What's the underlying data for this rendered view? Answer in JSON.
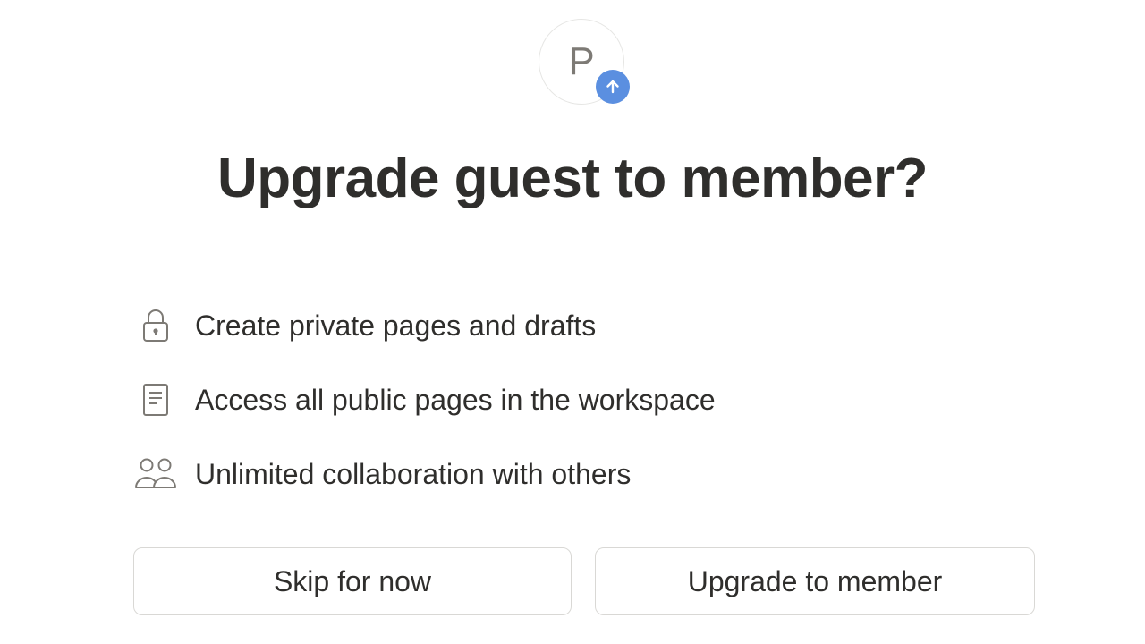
{
  "avatar": {
    "initial": "P",
    "badge_icon": "arrow-up-icon",
    "badge_color": "#5b8fe0"
  },
  "dialog": {
    "title": "Upgrade guest to member?"
  },
  "features": [
    {
      "icon": "lock-icon",
      "label": "Create private pages and drafts"
    },
    {
      "icon": "page-icon",
      "label": "Access all public pages in the workspace"
    },
    {
      "icon": "people-icon",
      "label": "Unlimited collaboration with others"
    }
  ],
  "actions": {
    "skip_label": "Skip for now",
    "upgrade_label": "Upgrade to member"
  }
}
